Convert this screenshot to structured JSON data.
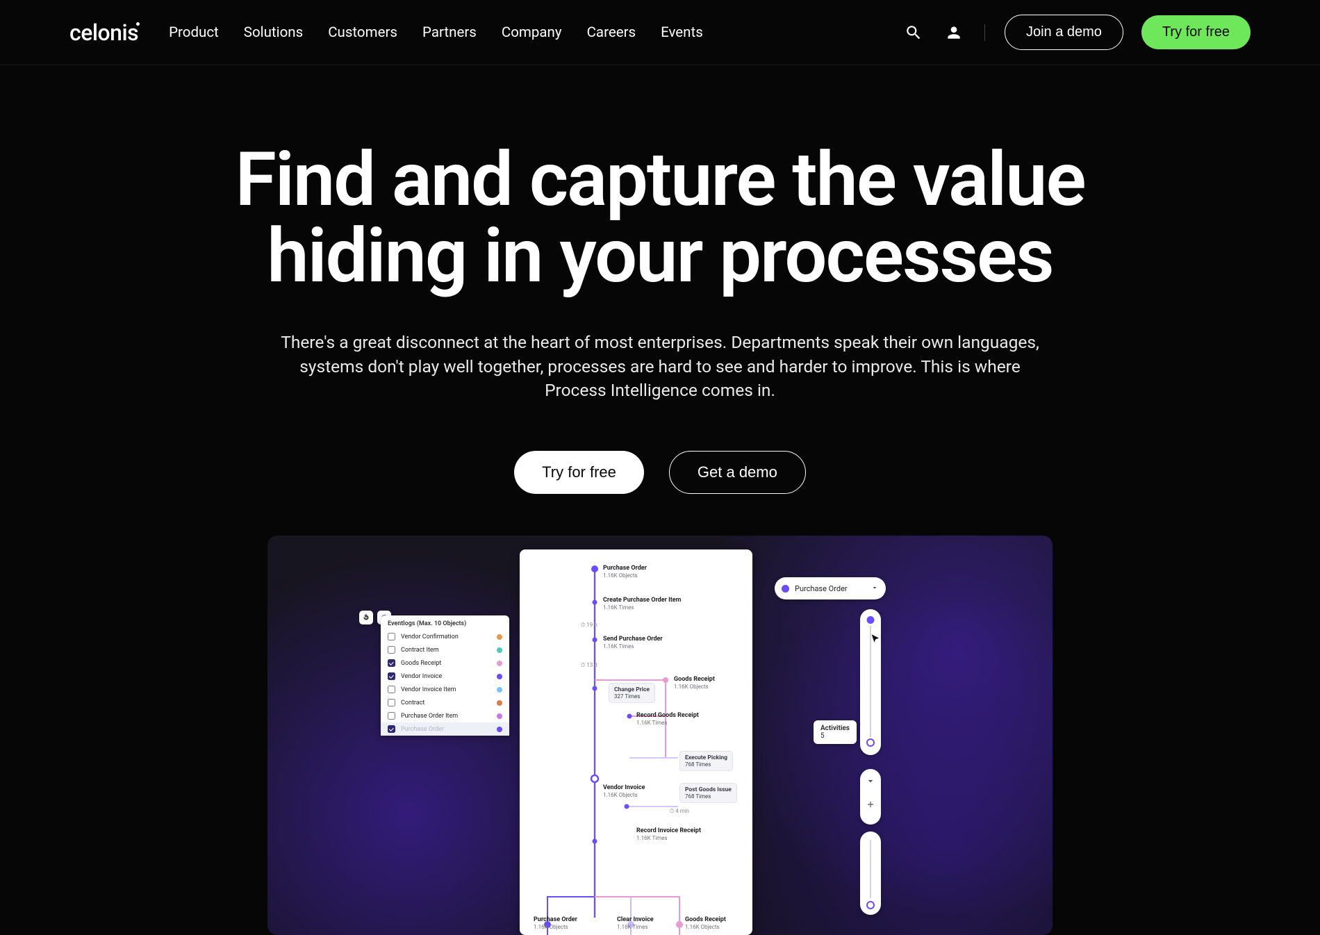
{
  "brand": "celonis",
  "nav": {
    "items": [
      "Product",
      "Solutions",
      "Customers",
      "Partners",
      "Company",
      "Careers",
      "Events"
    ]
  },
  "header_cta": {
    "demo": "Join a demo",
    "try": "Try for free"
  },
  "hero": {
    "title_line1": "Find and capture the value",
    "title_line2": "hiding in your processes",
    "body": "There's a great disconnect at the heart of most enterprises. Departments speak their own languages, systems don't play well together, processes are hard to see and harder to improve. This is where Process Intelligence comes in.",
    "cta_primary": "Try for free",
    "cta_secondary": "Get a demo"
  },
  "eventlogs": {
    "heading": "Eventlogs (Max. 10 Objects)",
    "items": [
      {
        "label": "Vendor Confirmation",
        "checked": false,
        "dot": "#e99a46"
      },
      {
        "label": "Contract Item",
        "checked": false,
        "dot": "#4fc8b9"
      },
      {
        "label": "Goods Receipt",
        "checked": true,
        "dot": "#e89ad2"
      },
      {
        "label": "Vendor Invoice",
        "checked": true,
        "dot": "#6b4dff"
      },
      {
        "label": "Vendor Invoice Item",
        "checked": false,
        "dot": "#7ac3f2"
      },
      {
        "label": "Contract",
        "checked": false,
        "dot": "#e07c49"
      },
      {
        "label": "Purchase Order Item",
        "checked": false,
        "dot": "#c977e8"
      },
      {
        "label": "Purchase Order",
        "checked": true,
        "dot": "#6b4dff",
        "muted": true
      }
    ]
  },
  "po_chip": {
    "label": "Purchase Order"
  },
  "activities": {
    "label": "Activities",
    "value": "5"
  },
  "flow": {
    "nodes": {
      "po": {
        "title": "Purchase Order",
        "sub": "1.16K Objects"
      },
      "create_poi": {
        "title": "Create Purchase Order Item",
        "sub": "1.16K Times"
      },
      "send_po": {
        "title": "Send Purchase Order",
        "sub": "1.16K Times"
      },
      "change_price": {
        "title": "Change Price",
        "sub": "327 Times"
      },
      "goods_receipt": {
        "title": "Goods Receipt",
        "sub": "1.16K Objects"
      },
      "record_gr": {
        "title": "Record Goods Receipt",
        "sub": "1.16K Times"
      },
      "exec_pick": {
        "title": "Execute Picking",
        "sub": "768 Times"
      },
      "vendor_inv": {
        "title": "Vendor Invoice",
        "sub": "1.16K Objects"
      },
      "post_gi": {
        "title": "Post Goods Issue",
        "sub": "768 Times"
      },
      "record_ir": {
        "title": "Record Invoice Receipt",
        "sub": "1.16K Times"
      },
      "po_bottom": {
        "title": "Purchase Order",
        "sub": "1.16K Objects"
      },
      "clear_inv": {
        "title": "Clear Invoice",
        "sub": "1.16K Times"
      },
      "gr_bottom": {
        "title": "Goods Receipt",
        "sub": "1.16K Objects"
      }
    },
    "edges": {
      "e1": "19 h",
      "e2": "13 d",
      "e3": "4 min"
    }
  }
}
